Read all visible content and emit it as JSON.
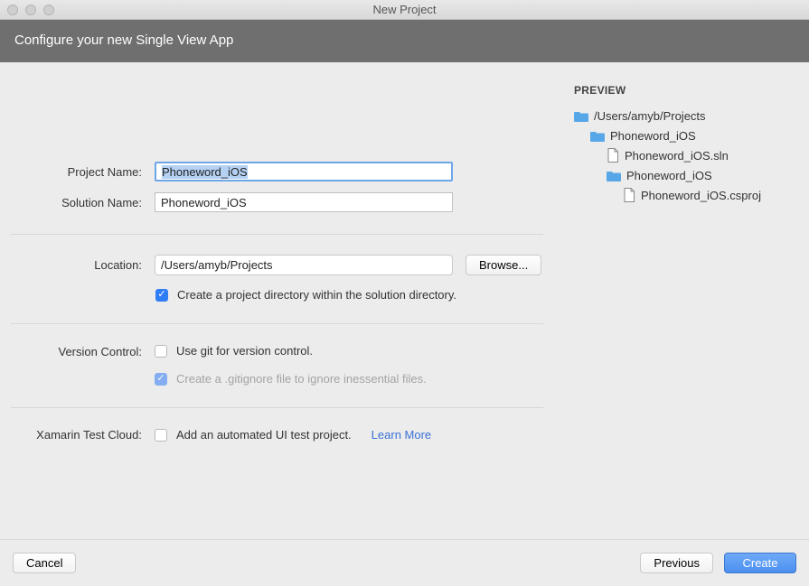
{
  "window": {
    "title": "New Project"
  },
  "subtitle": "Configure your new Single View App",
  "form": {
    "projectName": {
      "label": "Project Name:",
      "value": "Phoneword_iOS"
    },
    "solutionName": {
      "label": "Solution Name:",
      "value": "Phoneword_iOS"
    },
    "location": {
      "label": "Location:",
      "value": "/Users/amyb/Projects",
      "browse": "Browse..."
    },
    "createDir": {
      "label": "Create a project directory within the solution directory.",
      "checked": true
    },
    "versionControl": {
      "label": "Version Control:",
      "useGit": {
        "label": "Use git for version control.",
        "checked": false
      },
      "gitignore": {
        "label": "Create a .gitignore file to ignore inessential files.",
        "checked": true,
        "disabled": true
      }
    },
    "testCloud": {
      "label": "Xamarin Test Cloud:",
      "addTest": {
        "label": "Add an automated UI test project.",
        "checked": false
      },
      "learnMore": "Learn More"
    }
  },
  "preview": {
    "title": "PREVIEW",
    "tree": [
      {
        "indent": 1,
        "type": "folder",
        "name": "/Users/amyb/Projects"
      },
      {
        "indent": 2,
        "type": "folder",
        "name": "Phoneword_iOS"
      },
      {
        "indent": 3,
        "type": "file",
        "name": "Phoneword_iOS.sln"
      },
      {
        "indent": 3,
        "type": "folder",
        "name": "Phoneword_iOS"
      },
      {
        "indent": 4,
        "type": "file",
        "name": "Phoneword_iOS.csproj"
      }
    ]
  },
  "footer": {
    "cancel": "Cancel",
    "previous": "Previous",
    "create": "Create"
  }
}
